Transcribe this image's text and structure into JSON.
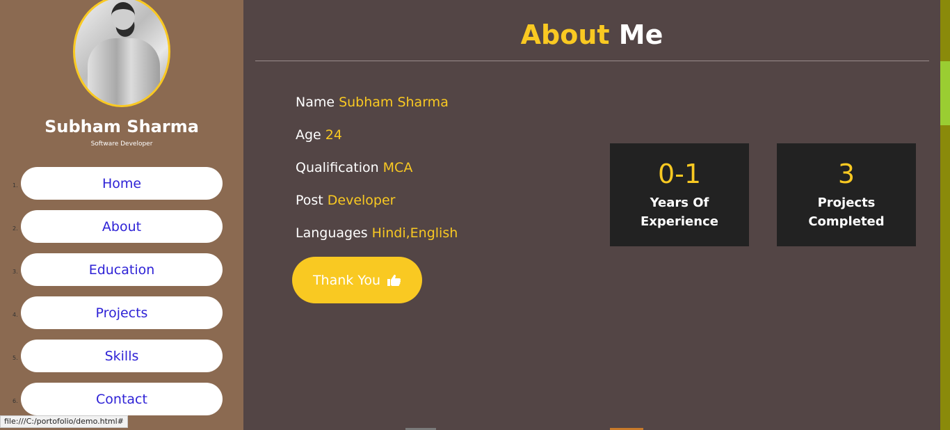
{
  "profile": {
    "name": "Subham Sharma",
    "role": "Software Developer"
  },
  "nav": {
    "items": [
      {
        "number": "1.",
        "label": "Home"
      },
      {
        "number": "2.",
        "label": "About"
      },
      {
        "number": "3.",
        "label": "Education"
      },
      {
        "number": "4.",
        "label": "Projects"
      },
      {
        "number": "5.",
        "label": "Skills"
      },
      {
        "number": "6.",
        "label": "Contact"
      }
    ]
  },
  "about": {
    "title_accent": "About",
    "title_rest": "Me",
    "rows": [
      {
        "label": "Name",
        "value": "Subham Sharma"
      },
      {
        "label": "Age",
        "value": "24"
      },
      {
        "label": "Qualification",
        "value": "MCA"
      },
      {
        "label": "Post",
        "value": "Developer"
      },
      {
        "label": "Languages",
        "value": "Hindi,English"
      }
    ],
    "thanks_label": "Thank You",
    "thanks_icon": "thumbs-up-icon"
  },
  "stats": [
    {
      "number": "0-1",
      "label": "Years Of Experience"
    },
    {
      "number": "3",
      "label": "Projects Completed"
    }
  ],
  "statusbar": {
    "url": "file:///C:/portofolio/demo.html#"
  },
  "colors": {
    "accent": "#f9c922",
    "sidebar": "#8b6a51",
    "main_bg": "#534545",
    "nav_text": "#2e22d6",
    "stat_bg": "#222222"
  }
}
